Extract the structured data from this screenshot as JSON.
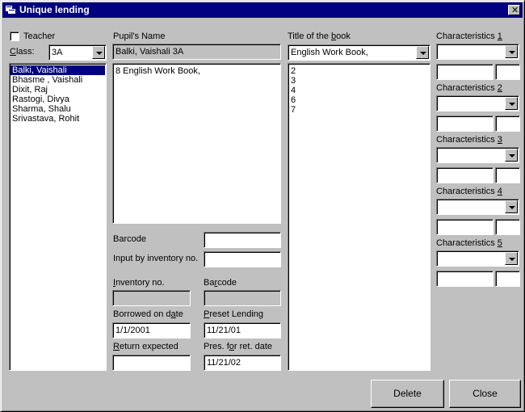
{
  "window": {
    "title": "Unique lending"
  },
  "left": {
    "teacher_label": "Teacher",
    "class_label": "Class:",
    "class_value": "3A",
    "pupils": [
      "Balki, Vaishali",
      "Bhasme , Vaishali",
      "Dixit, Raj",
      "Rastogi, Divya",
      "Sharma, Shalu",
      "Srivastava, Rohit"
    ]
  },
  "middle": {
    "pupil_name_label": "Pupil's Name",
    "pupil_name_value": "Balki, Vaishali  3A",
    "lent_items": [
      "8 English Work Book,"
    ],
    "barcode_label": "Barcode",
    "barcode_value": "",
    "inventory_input_label": "Input by inventory no.",
    "inventory_input_value": "",
    "inventory_no_label": "Inventory no.",
    "inventory_no_value": "",
    "barcode2_label": "Barcode",
    "barcode2_value": "",
    "borrowed_label": "Borrowed on date",
    "borrowed_value": "1/1/2001",
    "preset_label": "Preset Lending",
    "preset_value": "11/21/01",
    "return_label": "Return expected",
    "return_value": "",
    "pres_ret_label": "Pres. for ret. date",
    "pres_ret_value": "11/21/02"
  },
  "book": {
    "title_label": "Title of the book",
    "title_value": "English Work Book,",
    "copies": [
      "2",
      "3",
      "4",
      "6",
      "7"
    ]
  },
  "characteristics": [
    {
      "label": "Characteristics 1"
    },
    {
      "label": "Characteristics 2"
    },
    {
      "label": "Characteristics 3"
    },
    {
      "label": "Characteristics 4"
    },
    {
      "label": "Characteristics 5"
    }
  ],
  "buttons": {
    "delete": "Delete",
    "close": "Close"
  }
}
